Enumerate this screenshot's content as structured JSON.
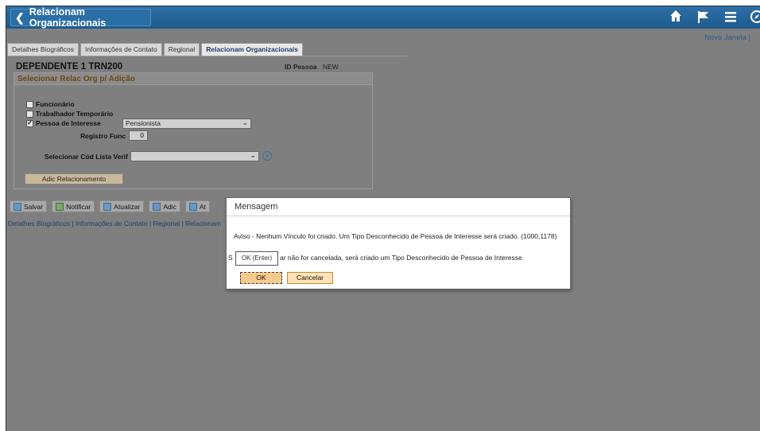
{
  "header": {
    "back_label": "Relacionam Organizacionais",
    "icons": [
      "home-icon",
      "flag-icon",
      "menu-icon",
      "navbar-icon"
    ]
  },
  "page": {
    "new_window": "Nova Janela |",
    "tabs": [
      {
        "label": "Detalhes Biográficos"
      },
      {
        "label": "Informações de Contato"
      },
      {
        "label": "Regional"
      },
      {
        "label": "Relacionam Organizacionais"
      }
    ],
    "heading": "DEPENDENTE 1 TRN200",
    "id_label": "ID Pessoa",
    "id_value": "NEW",
    "group_title": "Selecionar Relac Org p/ Adição",
    "checkboxes": [
      {
        "label": "Funcionário",
        "checked": false
      },
      {
        "label": "Trabalhador Temporário",
        "checked": false
      },
      {
        "label": "Pessoa de Interesse",
        "checked": true
      }
    ],
    "poi_select": "Pensionista",
    "registro_label": "Registro Func",
    "registro_value": "0",
    "checklist_label": "Selecionar Cód Lista Verif",
    "checklist_value": "",
    "add_button": "Adic Relacionamento",
    "toolbar": [
      "Salvar",
      "Notificar",
      "Atualizar",
      "Adic",
      "At"
    ],
    "links": "Detalhes Biográficos | Informações de Contato | Regional | Relacionam"
  },
  "modal": {
    "title": "Mensagem",
    "message1": "Aviso - Nenhum Vínculo foi criado. Um Tipo Desconhecido de Pessoa de Interesse será criado. (1000,1178)",
    "message2_prefix": "S",
    "message2": "ar não for cancelada, será criado um Tipo Desconhecido de Pessoa de Interesse.",
    "tooltip": "OK (Enter)",
    "ok_label": "OK",
    "cancel_label": "Cancelar"
  }
}
